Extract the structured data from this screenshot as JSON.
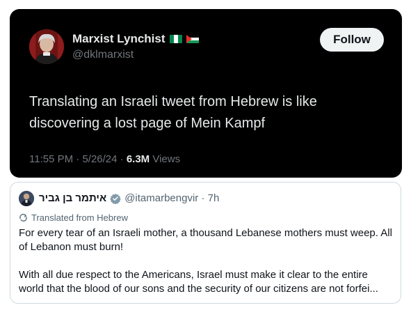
{
  "main_tweet": {
    "author_name": "Marxist Lynchist",
    "flags": [
      "nigeria-flag",
      "palestine-flag"
    ],
    "handle": "@dklmarxist",
    "follow_label": "Follow",
    "text": "Translating an Israeli tweet from Hebrew is like discovering a lost page of Mein Kampf",
    "time": "11:55 PM",
    "date": "5/26/24",
    "separator": " · ",
    "views_count": "6.3M",
    "views_label": "Views"
  },
  "quoted_tweet": {
    "author_name": "איתמר בן גביר",
    "verified_icon": "verified-badge-icon",
    "handle": "@itamarbengvir",
    "age": "7h",
    "separator": " · ",
    "translated_label": "Translated from Hebrew",
    "paragraph_1": "For every tear of an Israeli mother, a thousand Lebanese mothers must weep. All of Lebanon must burn!",
    "paragraph_2": "With all due respect to the Americans, Israel must make it clear to the entire world that the blood of our sons and the security of our citizens are not forfei..."
  },
  "colors": {
    "dark_bg": "#000000",
    "primary_text_dark": "#e7e9ea",
    "secondary_text_dark": "#71767b",
    "follow_bg": "#eff3f4",
    "verified": "#829aab"
  }
}
